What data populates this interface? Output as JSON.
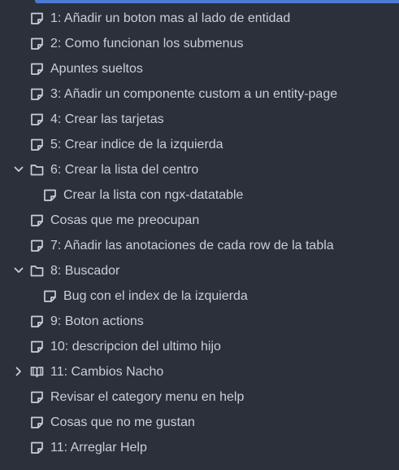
{
  "colors": {
    "background": "#2b303b",
    "text": "#c9ced8",
    "icon": "#c9ced8",
    "selected": "#4b7bd3"
  },
  "tree": {
    "items": [
      {
        "label": "1: Añadir un boton mas al lado de entidad",
        "icon": "note-icon",
        "depth": 1
      },
      {
        "label": "2: Como funcionan los submenus",
        "icon": "note-icon",
        "depth": 1
      },
      {
        "label": "Apuntes sueltos",
        "icon": "note-icon",
        "depth": 1
      },
      {
        "label": "3: Añadir un componente custom a un entity-page",
        "icon": "note-icon",
        "depth": 1
      },
      {
        "label": "4: Crear las tarjetas",
        "icon": "note-icon",
        "depth": 1
      },
      {
        "label": "5: Crear indice de la izquierda",
        "icon": "note-icon",
        "depth": 1
      },
      {
        "label": "6: Crear la lista del centro",
        "icon": "folder-icon",
        "depth": 1,
        "chevron": "chevron-down-icon"
      },
      {
        "label": "Crear la lista con ngx-datatable",
        "icon": "note-icon",
        "depth": 2
      },
      {
        "label": "Cosas que me preocupan",
        "icon": "note-icon",
        "depth": 1
      },
      {
        "label": "7: Añadir las anotaciones de cada row de la tabla",
        "icon": "note-icon",
        "depth": 1
      },
      {
        "label": "8: Buscador",
        "icon": "folder-icon",
        "depth": 1,
        "chevron": "chevron-down-icon"
      },
      {
        "label": "Bug con el index de la izquierda",
        "icon": "note-icon",
        "depth": 2
      },
      {
        "label": "9: Boton actions",
        "icon": "note-icon",
        "depth": 1
      },
      {
        "label": "10: descripcion del ultimo hijo",
        "icon": "note-icon",
        "depth": 1
      },
      {
        "label": "11: Cambios Nacho",
        "icon": "book-icon",
        "depth": 1,
        "chevron": "chevron-right-icon"
      },
      {
        "label": "Revisar el category menu en help",
        "icon": "note-icon",
        "depth": 1
      },
      {
        "label": "Cosas que no me gustan",
        "icon": "note-icon",
        "depth": 1
      },
      {
        "label": "11: Arreglar Help",
        "icon": "note-icon",
        "depth": 1
      }
    ]
  }
}
